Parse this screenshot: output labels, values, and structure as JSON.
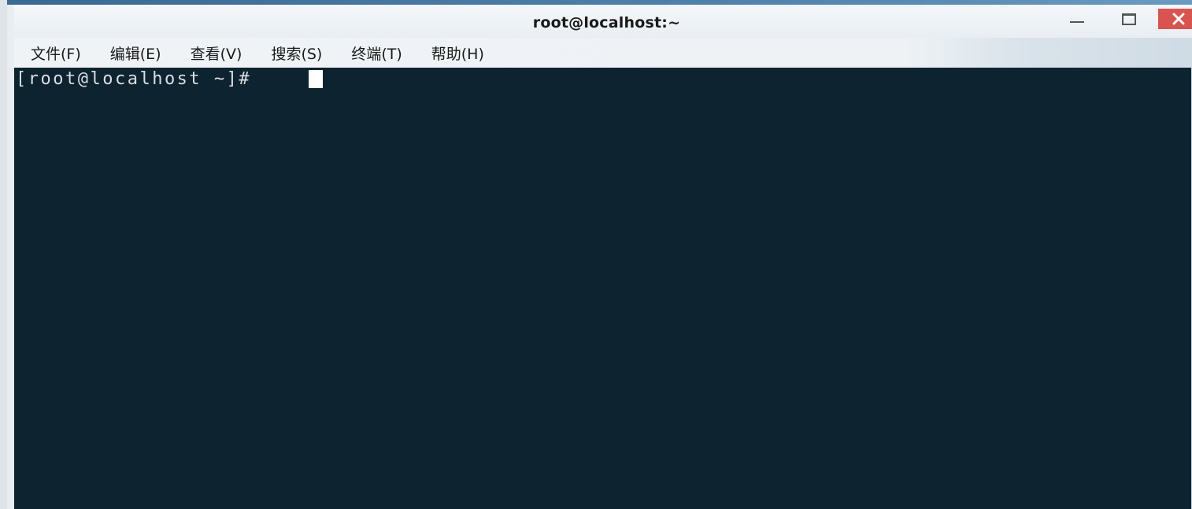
{
  "window": {
    "title": "root@localhost:~"
  },
  "menu": {
    "items": [
      {
        "label": "文件(F)"
      },
      {
        "label": "编辑(E)"
      },
      {
        "label": "查看(V)"
      },
      {
        "label": "搜索(S)"
      },
      {
        "label": "终端(T)"
      },
      {
        "label": "帮助(H)"
      }
    ]
  },
  "terminal": {
    "prompt": "[root@localhost ~]# "
  },
  "colors": {
    "terminal_bg": "#0d2330",
    "terminal_fg": "#d9dee2",
    "close_button": "#d9534f",
    "cursor": "#ffffff"
  },
  "icons": {
    "minimize": "minimize-icon",
    "maximize": "maximize-icon",
    "close": "close-icon"
  }
}
